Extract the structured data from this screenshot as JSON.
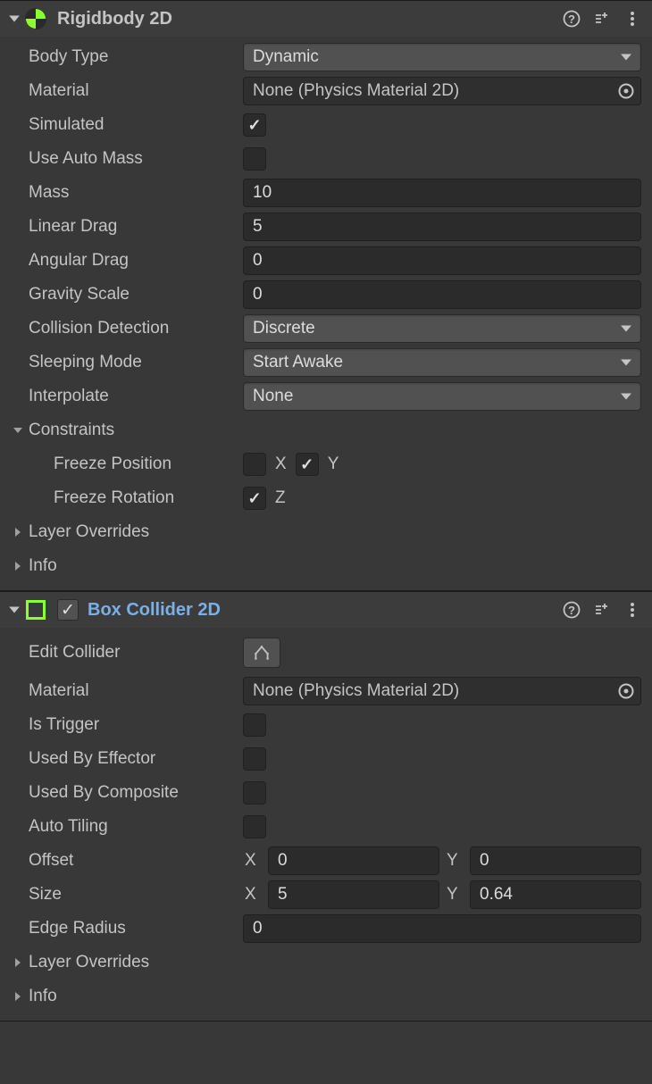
{
  "rigidbody": {
    "title": "Rigidbody 2D",
    "body_type_label": "Body Type",
    "body_type_value": "Dynamic",
    "material_label": "Material",
    "material_value": "None (Physics Material 2D)",
    "simulated_label": "Simulated",
    "simulated_checked": true,
    "use_auto_mass_label": "Use Auto Mass",
    "use_auto_mass_checked": false,
    "mass_label": "Mass",
    "mass_value": "10",
    "linear_drag_label": "Linear Drag",
    "linear_drag_value": "5",
    "angular_drag_label": "Angular Drag",
    "angular_drag_value": "0",
    "gravity_scale_label": "Gravity Scale",
    "gravity_scale_value": "0",
    "collision_detection_label": "Collision Detection",
    "collision_detection_value": "Discrete",
    "sleeping_mode_label": "Sleeping Mode",
    "sleeping_mode_value": "Start Awake",
    "interpolate_label": "Interpolate",
    "interpolate_value": "None",
    "constraints_label": "Constraints",
    "freeze_position_label": "Freeze Position",
    "freeze_position_x_label": "X",
    "freeze_position_x_checked": false,
    "freeze_position_y_label": "Y",
    "freeze_position_y_checked": true,
    "freeze_rotation_label": "Freeze Rotation",
    "freeze_rotation_z_label": "Z",
    "freeze_rotation_z_checked": true,
    "layer_overrides_label": "Layer Overrides",
    "info_label": "Info"
  },
  "boxcollider": {
    "title": "Box Collider 2D",
    "enabled": true,
    "edit_collider_label": "Edit Collider",
    "material_label": "Material",
    "material_value": "None (Physics Material 2D)",
    "is_trigger_label": "Is Trigger",
    "is_trigger_checked": false,
    "used_by_effector_label": "Used By Effector",
    "used_by_effector_checked": false,
    "used_by_composite_label": "Used By Composite",
    "used_by_composite_checked": false,
    "auto_tiling_label": "Auto Tiling",
    "auto_tiling_checked": false,
    "offset_label": "Offset",
    "offset_x_label": "X",
    "offset_x": "0",
    "offset_y_label": "Y",
    "offset_y": "0",
    "size_label": "Size",
    "size_x_label": "X",
    "size_x": "5",
    "size_y_label": "Y",
    "size_y": "0.64",
    "edge_radius_label": "Edge Radius",
    "edge_radius_value": "0",
    "layer_overrides_label": "Layer Overrides",
    "info_label": "Info"
  }
}
